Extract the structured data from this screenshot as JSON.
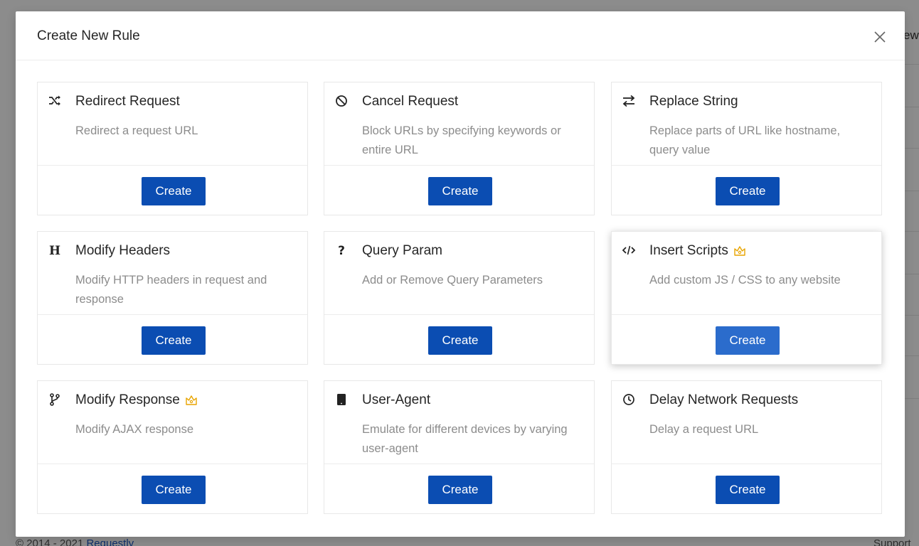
{
  "background": {
    "right_text": "ew",
    "footer_text": "© 2014 - 2021",
    "footer_link": "Requestly",
    "footer_right": "Support"
  },
  "modal": {
    "title": "Create New Rule",
    "close_icon": "close-icon"
  },
  "rules": [
    {
      "icon": "shuffle-icon",
      "title": "Redirect Request",
      "description": "Redirect a request URL",
      "button": "Create",
      "premium": false
    },
    {
      "icon": "block-icon",
      "title": "Cancel Request",
      "description": "Block URLs by specifying keywords or entire URL",
      "button": "Create",
      "premium": false
    },
    {
      "icon": "swap-arrows-icon",
      "title": "Replace String",
      "description": "Replace parts of URL like hostname, query value",
      "button": "Create",
      "premium": false
    },
    {
      "icon": "heading-icon",
      "title": "Modify Headers",
      "description": "Modify HTTP headers in request and response",
      "button": "Create",
      "premium": false
    },
    {
      "icon": "question-mark-icon",
      "title": "Query Param",
      "description": "Add or Remove Query Parameters",
      "button": "Create",
      "premium": false
    },
    {
      "icon": "code-icon",
      "title": "Insert Scripts",
      "description": "Add custom JS / CSS to any website",
      "button": "Create",
      "premium": true
    },
    {
      "icon": "branch-icon",
      "title": "Modify Response",
      "description": "Modify AJAX response",
      "button": "Create",
      "premium": true
    },
    {
      "icon": "tablet-icon",
      "title": "User-Agent",
      "description": "Emulate for different devices by varying user-agent",
      "button": "Create",
      "premium": false
    },
    {
      "icon": "clock-icon",
      "title": "Delay Network Requests",
      "description": "Delay a request URL",
      "button": "Create",
      "premium": false
    }
  ],
  "colors": {
    "primary_button": "#0b4db2",
    "hover_button": "#2b6ccc",
    "premium_crown": "#e8a400",
    "description_text": "#8c8c8c"
  }
}
